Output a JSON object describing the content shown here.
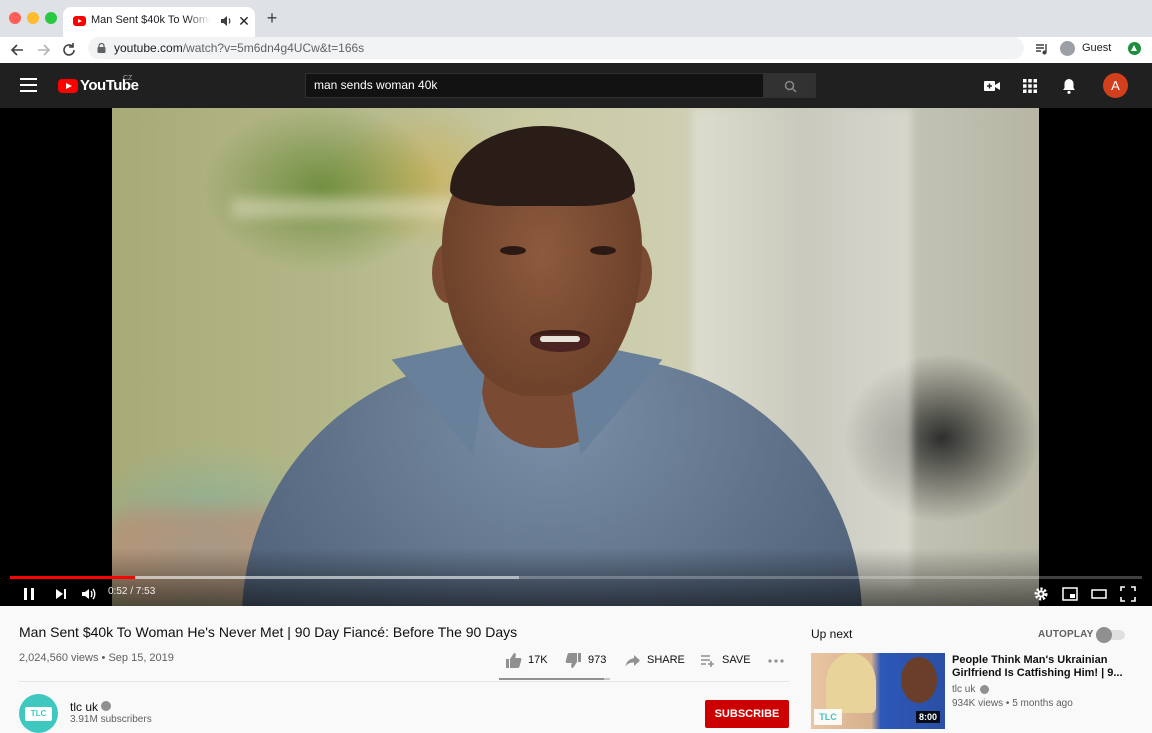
{
  "browser": {
    "tab_title": "Man Sent $40k To Woman He's Never Met | 90 Day Fiancé: Before The 90 Days",
    "url_host": "youtube.com",
    "url_rest": "/watch?v=5m6dn4g4UCw&t=166s",
    "profile_label": "Guest"
  },
  "masthead": {
    "logo_text": "YouTube",
    "country_code": "CZ",
    "search_value": "man sends woman 40k",
    "avatar_letter": "A"
  },
  "player": {
    "time_text": "0:52 / 7:53",
    "progress_played": 0.11,
    "progress_loaded": 0.45
  },
  "video": {
    "title": "Man Sent $40k To Woman He's Never Met | 90 Day Fiancé: Before The 90 Days",
    "meta": "2,024,560 views • Sep 15, 2019",
    "likes": "17K",
    "dislikes": "973",
    "like_ratio": 0.946,
    "share_label": "SHARE",
    "save_label": "SAVE"
  },
  "channel": {
    "name": "tlc uk",
    "subscribers": "3.91M subscribers",
    "avatar_text": "TLC",
    "subscribe_label": "SUBSCRIBE"
  },
  "sidebar": {
    "up_next_label": "Up next",
    "autoplay_label": "AUTOPLAY",
    "next_video": {
      "title": "People Think Man's Ukrainian Girlfriend Is Catfishing Him! | 9...",
      "channel": "tlc uk",
      "meta": "934K views • 5 months ago",
      "duration": "8:00",
      "thumb_logo": "TLC"
    }
  },
  "colors": {
    "accent": "#ff0000",
    "subscribe": "#cc0000",
    "masthead": "#202020"
  }
}
